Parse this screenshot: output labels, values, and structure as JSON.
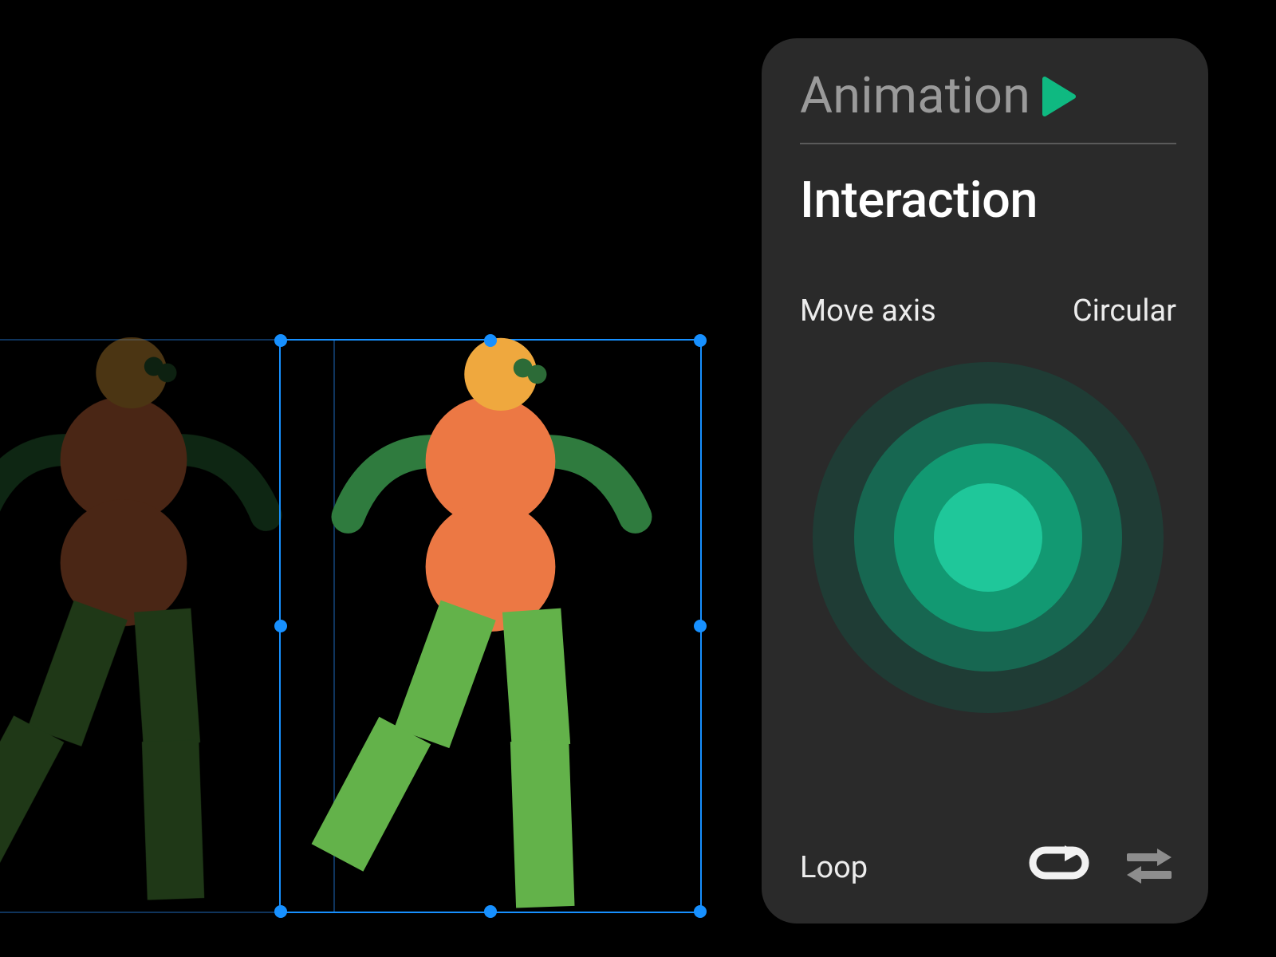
{
  "panel": {
    "title": "Animation",
    "section_title": "Interaction",
    "move_axis_label": "Move axis",
    "move_axis_value": "Circular",
    "loop_label": "Loop"
  },
  "colors": {
    "accent_green": "#0fb981",
    "play_green": "#0fb981",
    "panel_bg": "#2a2a2a",
    "selection_blue": "#1790ff",
    "figure_orange": "#ec7844",
    "figure_head": "#efa83e",
    "figure_dark_green": "#2f7b3e",
    "figure_light_green": "#63b24a",
    "figure_eye": "#2c6b37"
  },
  "icons": {
    "play": "play-icon",
    "loop": "loop-icon",
    "swap": "swap-arrows-icon"
  },
  "canvas": {
    "frames": [
      "ghost",
      "selected"
    ]
  }
}
